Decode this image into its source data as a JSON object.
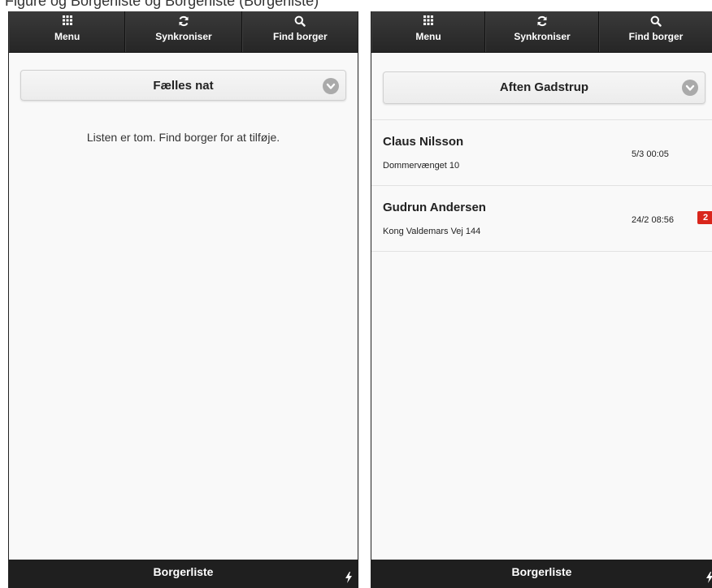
{
  "caption": "Figure og Borgerliste og Borgerliste (Borgerliste)",
  "screens": [
    {
      "toolbar": {
        "menu_label": "Menu",
        "sync_label": "Synkroniser",
        "find_label": "Find borger"
      },
      "selector": {
        "value": "Fælles nat"
      },
      "empty_message": "Listen er tom. Find borger for at tilføje.",
      "footer_title": "Borgerliste"
    },
    {
      "toolbar": {
        "menu_label": "Menu",
        "sync_label": "Synkroniser",
        "find_label": "Find borger"
      },
      "selector": {
        "value": "Aften Gadstrup"
      },
      "citizens": [
        {
          "name": "Claus Nilsson",
          "address": "Dommervænget 10",
          "time": "5/3 00:05"
        },
        {
          "name": "Gudrun Andersen",
          "address": "Kong Valdemars Vej 144",
          "time": "24/2 08:56",
          "badge": "2"
        }
      ],
      "footer_title": "Borgerliste"
    }
  ],
  "icons": {
    "menu": "grid-icon",
    "sync": "refresh-icon",
    "find": "search-icon",
    "dropdown": "chevron-down-icon",
    "footer": "lightning-bolt-icon"
  },
  "colors": {
    "toolbar": "#2a2a2a",
    "background": "#f9f9f9",
    "badge": "#d9261c",
    "footer": "#1f1f1f"
  }
}
